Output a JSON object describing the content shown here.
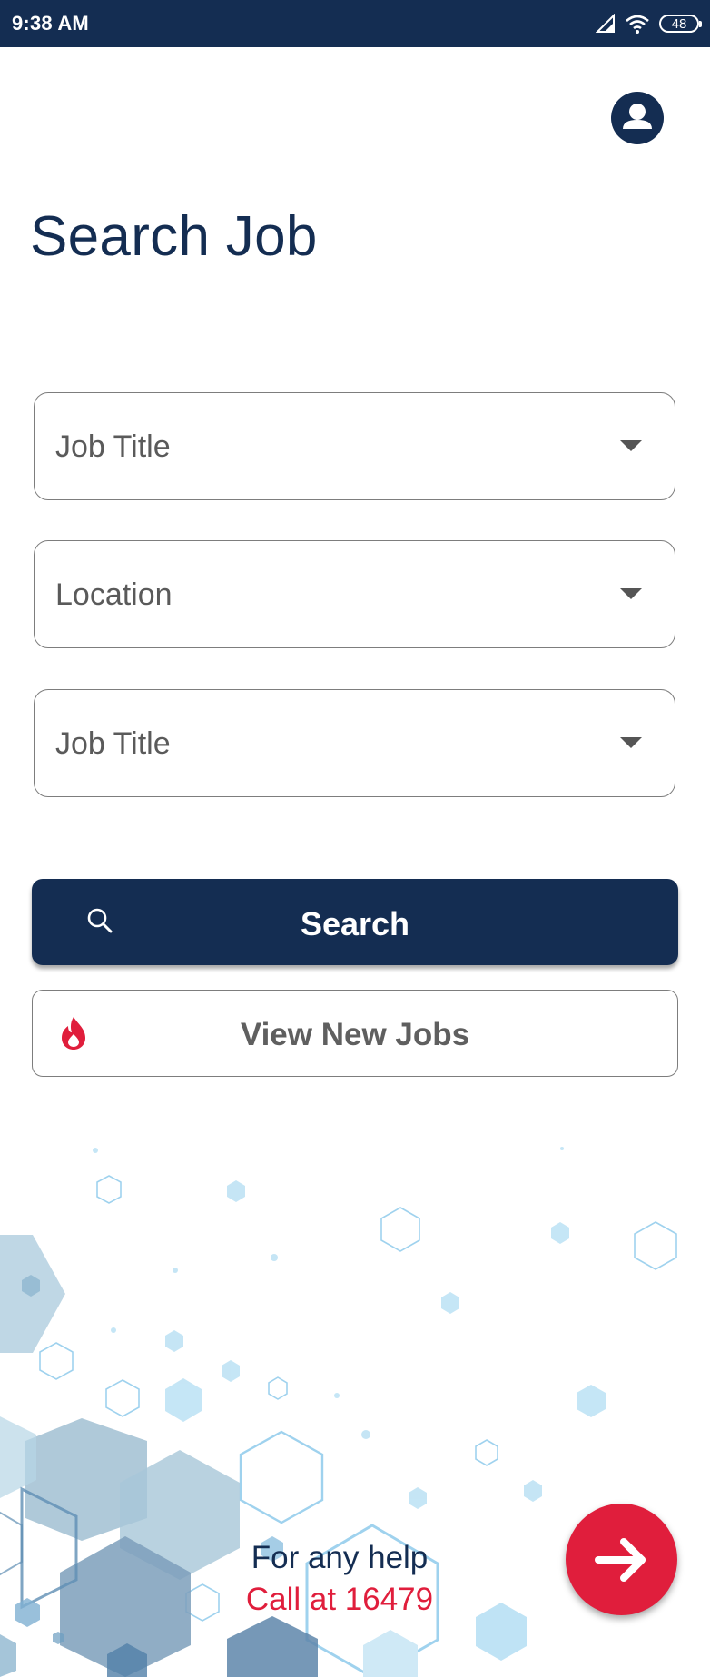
{
  "status_bar": {
    "time": "9:38 AM",
    "battery": "48"
  },
  "header": {
    "title": "Search Job",
    "profile_icon": "user-account-icon"
  },
  "form": {
    "fields": [
      {
        "label": "Job Title"
      },
      {
        "label": "Location"
      },
      {
        "label": "Job Title"
      }
    ]
  },
  "actions": {
    "search_label": "Search",
    "new_jobs_label": "View New Jobs",
    "new_jobs_icon": "flame-icon",
    "search_icon": "search-icon"
  },
  "help": {
    "line1": "For any help",
    "line2": "Call at 16479"
  },
  "fab": {
    "icon": "arrow-right-icon"
  },
  "colors": {
    "primary": "#142d52",
    "accent": "#e01e3c"
  }
}
